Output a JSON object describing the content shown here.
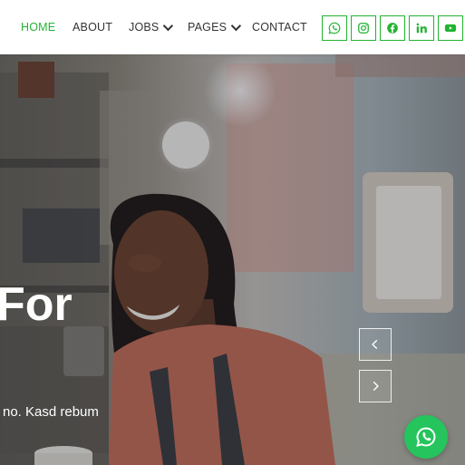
{
  "nav": {
    "items": [
      {
        "label": "HOME",
        "active": true
      },
      {
        "label": "ABOUT"
      },
      {
        "label": "JOBS",
        "dropdown": true
      },
      {
        "label": "PAGES",
        "dropdown": true
      },
      {
        "label": "CONTACT"
      }
    ],
    "social": [
      "whatsapp-icon",
      "instagram-icon",
      "facebook-icon",
      "linkedin-icon",
      "youtube-icon"
    ]
  },
  "hero": {
    "heading": "For",
    "text": "no. Kasd rebum"
  },
  "colors": {
    "accent": "#23b332",
    "whatsapp": "#25c45c"
  }
}
